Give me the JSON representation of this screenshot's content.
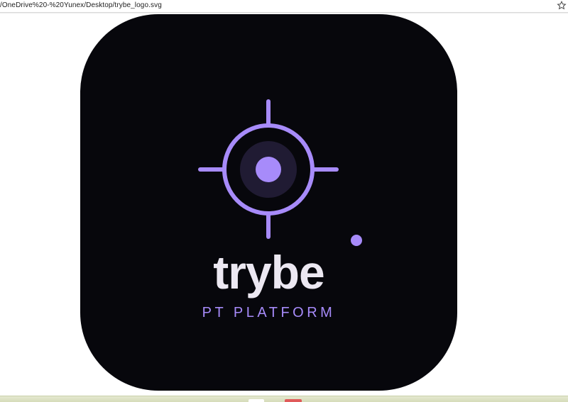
{
  "browser": {
    "address_text": "/OneDrive%20-%20Yunex/Desktop/trybe_logo.svg",
    "bookmark_icon": "star-icon"
  },
  "logo": {
    "brand_name": "trybe",
    "tagline": "PT PLATFORM",
    "icon": "crosshair-target-icon",
    "colors": {
      "background": "#07070c",
      "accent": "#a78bfa",
      "inner_ring": "#201b33",
      "brand_text": "#ece8f2"
    }
  },
  "taskbar": {
    "colors": {
      "strip": "#dde2c2",
      "item_1": "#ffffff",
      "item_2": "#e05a5a"
    }
  }
}
